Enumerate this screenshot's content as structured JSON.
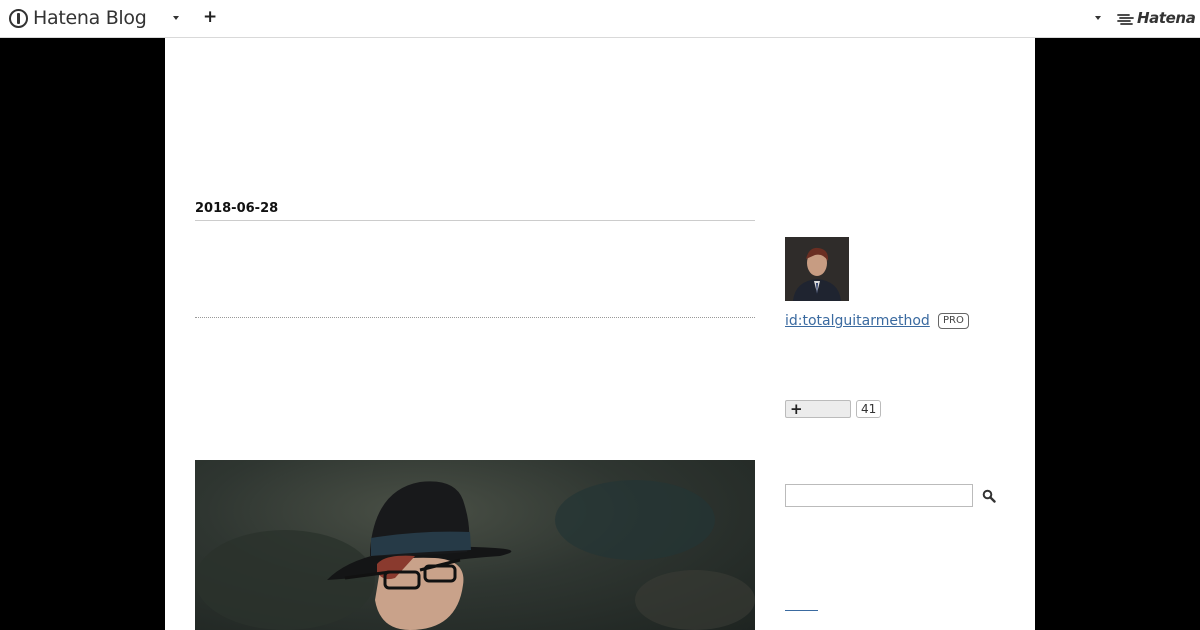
{
  "header": {
    "brand_name": "Hatena Blog",
    "hatena_label": "Hatena",
    "icons": [
      "hatena-blog-logo-icon",
      "dropdown-caret-icon",
      "plus-icon",
      "dropdown-caret-icon",
      "hatena-logo-icon"
    ]
  },
  "entry": {
    "date": "2018-06-28"
  },
  "sidebar": {
    "user_id": "id:totalguitarmethod",
    "pro_badge": "PRO",
    "subscribe_count": "41",
    "search_icon": "search-icon"
  },
  "colors": {
    "background": "#000000",
    "page": "#ffffff",
    "link": "#3a6aa0"
  }
}
